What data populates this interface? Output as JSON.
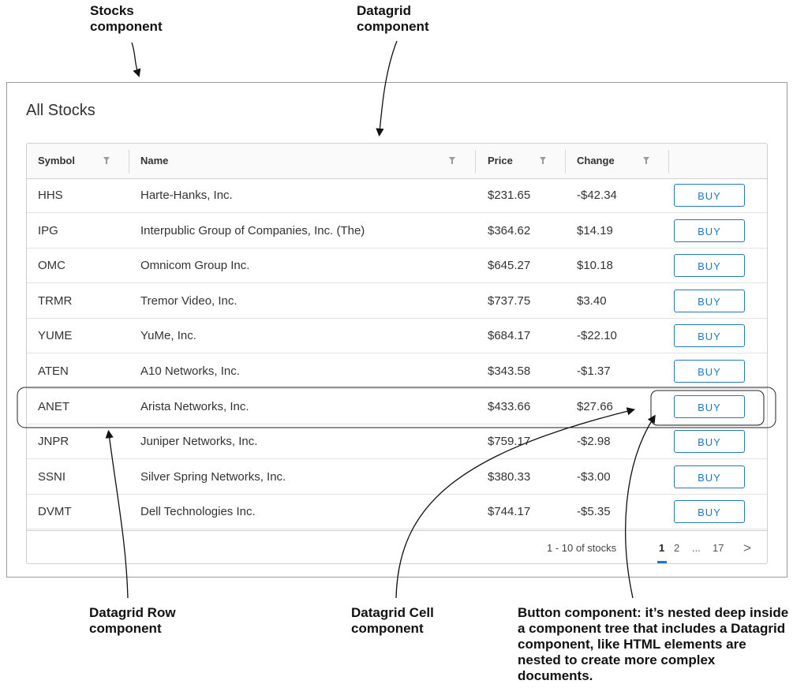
{
  "annotations": {
    "stocks_component": "Stocks component",
    "datagrid_component": "Datagrid component",
    "datagrid_row_component": "Datagrid Row component",
    "datagrid_cell_component": "Datagrid Cell component",
    "button_component": "Button component: it’s nested deep inside a component tree that includes a Datagrid component, like HTML elements are nested to create more complex documents."
  },
  "panel": {
    "title": "All Stocks"
  },
  "columns": {
    "symbol": "Symbol",
    "name": "Name",
    "price": "Price",
    "change": "Change"
  },
  "rows": [
    {
      "symbol": "HHS",
      "name": "Harte-Hanks, Inc.",
      "price": "$231.65",
      "change": "-$42.34",
      "action": "BUY"
    },
    {
      "symbol": "IPG",
      "name": "Interpublic Group of Companies, Inc. (The)",
      "price": "$364.62",
      "change": "$14.19",
      "action": "BUY"
    },
    {
      "symbol": "OMC",
      "name": "Omnicom Group Inc.",
      "price": "$645.27",
      "change": "$10.18",
      "action": "BUY"
    },
    {
      "symbol": "TRMR",
      "name": "Tremor Video, Inc.",
      "price": "$737.75",
      "change": "$3.40",
      "action": "BUY"
    },
    {
      "symbol": "YUME",
      "name": "YuMe, Inc.",
      "price": "$684.17",
      "change": "-$22.10",
      "action": "BUY"
    },
    {
      "symbol": "ATEN",
      "name": "A10 Networks, Inc.",
      "price": "$343.58",
      "change": "-$1.37",
      "action": "BUY"
    },
    {
      "symbol": "ANET",
      "name": "Arista Networks, Inc.",
      "price": "$433.66",
      "change": "$27.66",
      "action": "BUY"
    },
    {
      "symbol": "JNPR",
      "name": "Juniper Networks, Inc.",
      "price": "$759.17",
      "change": "-$2.98",
      "action": "BUY"
    },
    {
      "symbol": "SSNI",
      "name": "Silver Spring Networks, Inc.",
      "price": "$380.33",
      "change": "-$3.00",
      "action": "BUY"
    },
    {
      "symbol": "DVMT",
      "name": "Dell Technologies Inc.",
      "price": "$744.17",
      "change": "-$5.35",
      "action": "BUY"
    }
  ],
  "footer": {
    "summary": "1 - 10 of stocks",
    "pages": [
      "1",
      "2",
      "...",
      "17"
    ],
    "current_page": "1",
    "next_glyph": ">"
  },
  "icons": {
    "filter": "filter-icon",
    "next": "chevron-right-icon"
  },
  "colors": {
    "accent": "#1f78c9",
    "border": "#cfcfcf"
  }
}
